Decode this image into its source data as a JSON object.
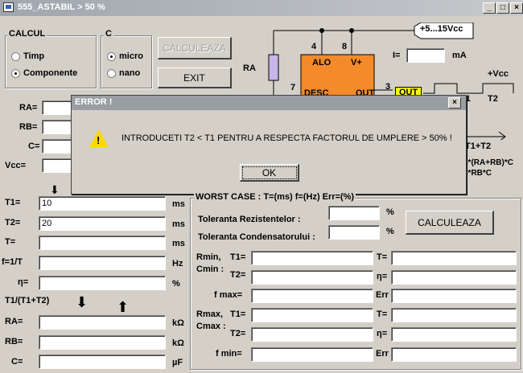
{
  "window": {
    "title": "555_ASTABIL > 50 %",
    "min_label": "_",
    "max_label": "□",
    "close_label": "×"
  },
  "calcul": {
    "title": "CALCUL",
    "opt1": "Timp",
    "opt2": "Componente"
  },
  "unit": {
    "title": "C",
    "opt1": "micro",
    "opt2": "nano"
  },
  "buttons": {
    "calc_top": "CALCULEAZA",
    "exit": "EXIT",
    "calc_right": "CALCULEAZA"
  },
  "circuit": {
    "supply": "+5...15Vcc",
    "pin4": "4",
    "pin8": "8",
    "alo": "ALO",
    "vplus": "V+",
    "ra": "RA",
    "i_label": "I=",
    "ma": "mA",
    "vcc": "+Vcc",
    "pin7": "7",
    "desc": "DESC",
    "out": "OUT",
    "pin3": "3",
    "out_tag": "OUT",
    "t1": "T1",
    "t2": "T2",
    "t1t2": "T1+T2",
    "f1": "3*(RA+RB)*C",
    "f2": "3*RB*C"
  },
  "left": {
    "ra": "RA=",
    "rb": "RB=",
    "c": "C=",
    "vcc": "Vcc=",
    "t1": "T1=",
    "t1_val": "10",
    "t1_unit": "ms",
    "t2": "T2=",
    "t2_val": "20",
    "t2_unit": "ms",
    "t": "T=",
    "t_unit": "ms",
    "f": "f=1/T",
    "f_unit": "Hz",
    "eta": "η=",
    "eta_unit": "%",
    "ratio": "T1/(T1+T2)",
    "ra2": "RA=",
    "ra2_unit": "kΩ",
    "rb2": "RB=",
    "rb2_unit": "kΩ",
    "c2": "C=",
    "c2_unit": "µF"
  },
  "worst": {
    "header": "WORST CASE :  T=(ms)  f=(Hz)  Err=(%)",
    "tol_r": "Toleranta Rezistentelor  :",
    "tol_c": "Toleranta Condensatorului :",
    "pct": "%",
    "rmin": "Rmin,",
    "cmin": "Cmin :",
    "t1": "T1=",
    "t2": "T2=",
    "t": "T=",
    "eta": "η=",
    "fmax": "f max=",
    "err": "Err",
    "rmax": "Rmax,",
    "cmax": "Cmax :",
    "fmin": "f min="
  },
  "dialog": {
    "title": "ERROR !",
    "close": "×",
    "message": "INTRODUCETI T2 < T1 PENTRU A RESPECTA FACTORUL DE UMPLERE > 50% !",
    "ok": "OK",
    "warn": "!"
  },
  "colors": {
    "chip": "#f48a2a",
    "resistor": "#c9b6e8",
    "out_tag": "#ffff00",
    "warning": "#ffd800"
  }
}
